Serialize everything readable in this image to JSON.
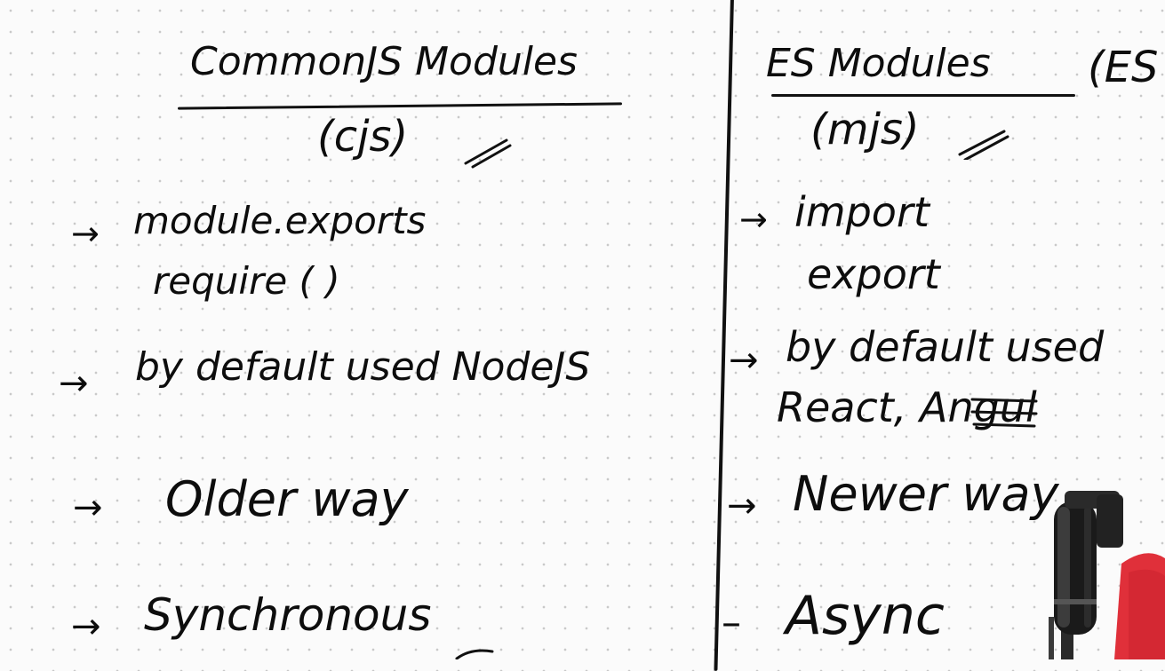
{
  "left": {
    "title": "CommonJS Modules",
    "subtitle": "(cjs)",
    "item1_line1": "module.exports",
    "item1_line2": "require ( )",
    "item2": "by default used NodeJS",
    "item3": "Older way",
    "item4": "Synchronous"
  },
  "right": {
    "title": "ES Modules",
    "title_extra": "(ES",
    "subtitle": "(mjs)",
    "item1_line1": "import",
    "item1_line2": "export",
    "item2_line1": "by default used",
    "item2_line2": "React, Ang",
    "item2_line2_tail": "ul",
    "item3": "Newer way",
    "item4": "Async"
  },
  "arrow_glyph": "→",
  "dash_glyph": "–",
  "colors": {
    "ink": "#0d0d0d",
    "paper": "#fbfbfb",
    "grid_dot": "#c9c9c9",
    "mic_body": "#1a1a1a",
    "shirt": "#e0303a"
  },
  "icons": {
    "microphone": "microphone-icon"
  }
}
